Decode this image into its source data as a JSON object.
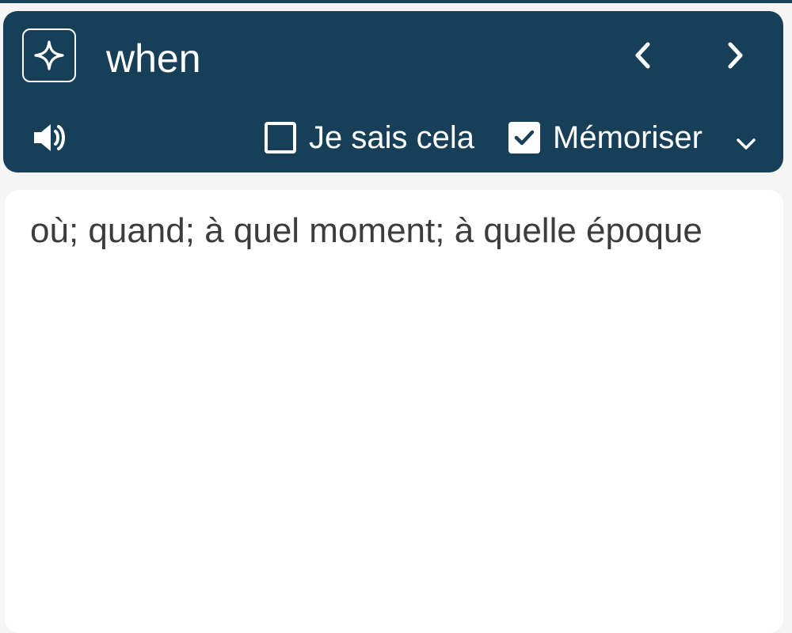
{
  "header": {
    "word": "when",
    "icons": {
      "ai": "sparkle-icon",
      "prev": "chevron-left-icon",
      "next": "chevron-right-icon",
      "speaker": "speaker-icon",
      "dropdown": "chevron-down-icon"
    },
    "options": {
      "known_label": "Je sais cela",
      "known_checked": false,
      "memorize_label": "Mémoriser",
      "memorize_checked": true
    }
  },
  "content": {
    "translation": "où; quand; à quel moment; à quelle époque"
  },
  "colors": {
    "header_bg": "#174058",
    "page_bg": "#f5f5f5",
    "card_bg": "#ffffff",
    "text": "#3c3c3c"
  }
}
